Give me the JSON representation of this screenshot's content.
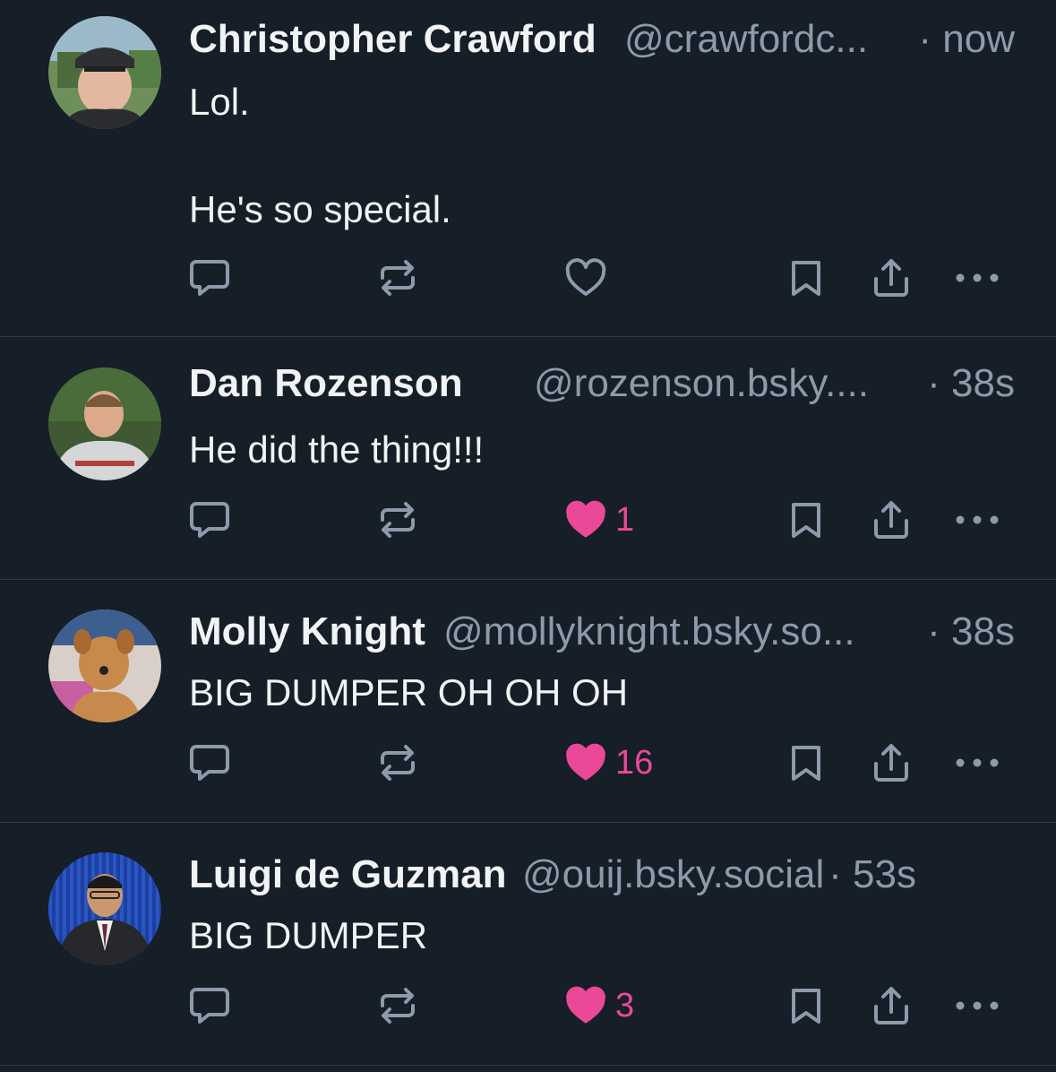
{
  "posts": [
    {
      "name": "Christopher Crawford",
      "handle": "@crawfordc...",
      "time": "· now",
      "text": "Lol.\n\nHe's so special.",
      "liked": false,
      "like_count": ""
    },
    {
      "name": "Dan Rozenson",
      "handle": "@rozenson.bsky....",
      "time": "· 38s",
      "text": "He did the thing!!!",
      "liked": true,
      "like_count": "1"
    },
    {
      "name": "Molly Knight",
      "handle": "@mollyknight.bsky.so...",
      "time": "· 38s",
      "text": "BIG DUMPER OH OH OH",
      "liked": true,
      "like_count": "16"
    },
    {
      "name": "Luigi de Guzman",
      "handle": "@ouij.bsky.social",
      "time": "· 53s",
      "text": "BIG DUMPER",
      "liked": true,
      "like_count": "3"
    }
  ],
  "icons": {
    "reply": "reply-icon",
    "repost": "repost-icon",
    "like": "heart-icon",
    "bookmark": "bookmark-icon",
    "share": "share-icon",
    "more": "more-icon"
  },
  "colors": {
    "background": "#161e27",
    "name": "#f1f3f5",
    "meta": "#8d9aab",
    "icon": "#8d9aab",
    "like": "#ec4899",
    "divider": "#2e3a47"
  }
}
